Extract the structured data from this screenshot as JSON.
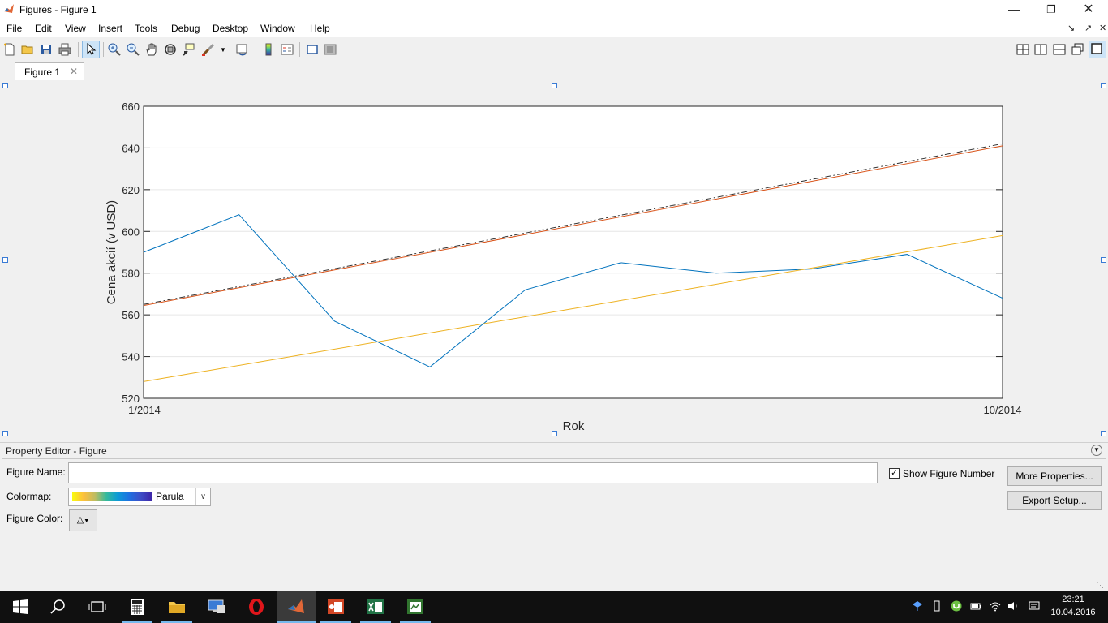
{
  "window": {
    "title": "Figures - Figure 1",
    "minimize_icon": "minimize-icon",
    "maximize_icon": "restore-icon",
    "close_icon": "close-icon"
  },
  "menu": {
    "items": [
      "File",
      "Edit",
      "View",
      "Insert",
      "Tools",
      "Debug",
      "Desktop",
      "Window",
      "Help"
    ]
  },
  "tabs": [
    {
      "label": "Figure 1",
      "close_glyph": "✕"
    }
  ],
  "toolbar": {
    "icons": [
      "new-figure-icon",
      "open-icon",
      "save-icon",
      "print-icon",
      "edit-plot-icon",
      "zoom-in-icon",
      "zoom-out-icon",
      "pan-icon",
      "rotate-3d-icon",
      "data-cursor-icon",
      "brush-icon",
      "link-plot-icon",
      "insert-colorbar-icon",
      "insert-legend-icon",
      "hide-plot-tools-icon",
      "show-plot-tools-icon"
    ],
    "layout_icons": [
      "tile-grid-icon",
      "left-right-icon",
      "top-bottom-icon",
      "float-icon",
      "maximize-icon"
    ]
  },
  "chart_data": {
    "type": "line",
    "title": "",
    "xlabel": "Rok",
    "ylabel": "Cena akcií (v USD)",
    "x_tick_labels": [
      "1/2014",
      "10/2014"
    ],
    "y_ticks": [
      520,
      540,
      560,
      580,
      600,
      620,
      640,
      660
    ],
    "ylim": [
      520,
      660
    ],
    "xlim": [
      1,
      10
    ],
    "grid": "horizontal",
    "series": [
      {
        "color": "#0072bd",
        "style": "solid",
        "x": [
          1,
          2,
          3,
          4,
          5,
          6,
          7,
          8,
          9,
          10
        ],
        "y": [
          590,
          608,
          557,
          535,
          572,
          585,
          580,
          582,
          589,
          568
        ]
      },
      {
        "color": "#d95319",
        "style": "solid",
        "x": [
          1,
          10
        ],
        "y": [
          564.5,
          641
        ]
      },
      {
        "color": "#333333",
        "style": "dashdot",
        "x": [
          1,
          10
        ],
        "y": [
          565,
          642
        ]
      },
      {
        "color": "#edb120",
        "style": "solid",
        "x": [
          1,
          10
        ],
        "y": [
          528,
          598
        ]
      }
    ]
  },
  "property_editor": {
    "title": "Property Editor - Figure",
    "figure_name_label": "Figure Name:",
    "figure_name_value": "",
    "show_number_label": "Show Figure Number",
    "show_number_checked": "✓",
    "more_properties": "More Properties...",
    "export_setup": "Export Setup...",
    "colormap_label": "Colormap:",
    "colormap_value": "Parula",
    "figure_color_label": "Figure Color:"
  },
  "taskbar": {
    "apps": [
      "start-icon",
      "search-icon",
      "task-view-icon",
      "calculator-icon",
      "file-explorer-icon",
      "remote-desktop-icon",
      "opera-icon",
      "matlab-icon",
      "powerpoint-icon",
      "excel-icon",
      "project-icon"
    ],
    "time": "23:21",
    "date": "10.04.2016"
  }
}
